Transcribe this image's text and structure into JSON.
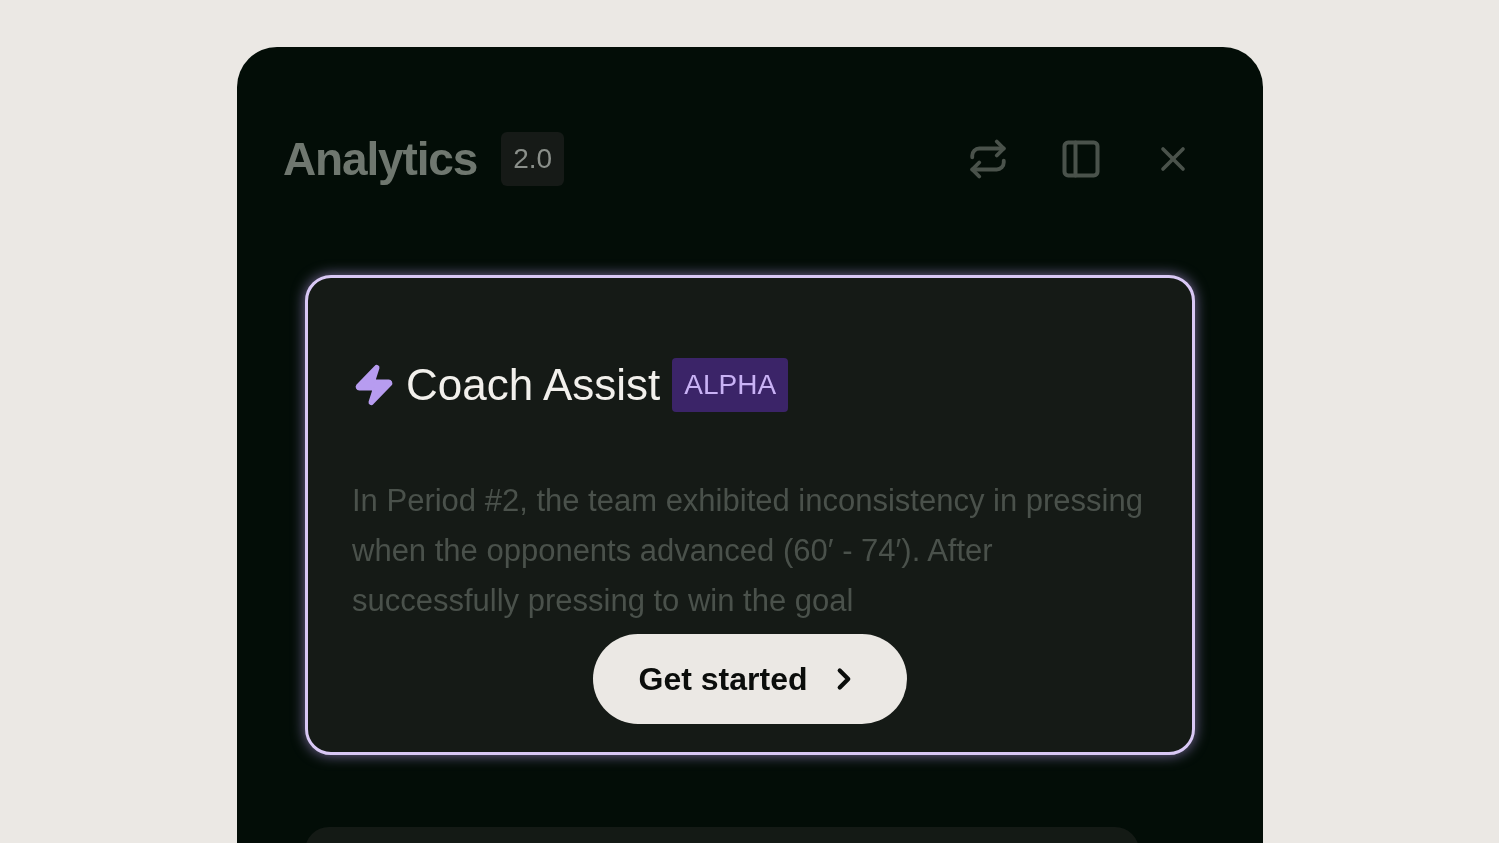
{
  "panel": {
    "title": "Analytics",
    "version": "2.0"
  },
  "card": {
    "title": "Coach Assist",
    "badge": "ALPHA",
    "summary": "In Period #2, the team exhibited inconsistency in pressing when the opponents advanced (60′ - 74′). After successfully pressing to win the goal",
    "button": "Get started"
  }
}
